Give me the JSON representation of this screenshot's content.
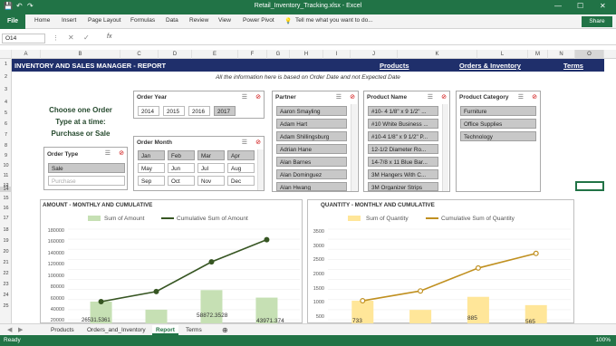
{
  "window": {
    "title": "Retail_Inventory_Tracking.xlsx - Excel",
    "minimize": "—",
    "maximize": "☐",
    "close": "✕"
  },
  "ribbon": {
    "file": "File",
    "tabs": [
      "Home",
      "Insert",
      "Page Layout",
      "Formulas",
      "Data",
      "Review",
      "View",
      "Power Pivot"
    ],
    "tell": "Tell me what you want to do...",
    "share": "Share"
  },
  "formula_bar": {
    "namebox": "O14",
    "fx": "fx",
    "value": ""
  },
  "columns": [
    "A",
    "B",
    "C",
    "D",
    "E",
    "F",
    "G",
    "H",
    "I",
    "J",
    "K",
    "L",
    "M",
    "N",
    "O"
  ],
  "rows": [
    "1",
    "2",
    "3",
    "4",
    "5",
    "6",
    "7",
    "8",
    "9",
    "10",
    "11",
    "12",
    "13",
    "14",
    "15",
    "16",
    "17",
    "18",
    "19",
    "20",
    "21",
    "22",
    "23",
    "24",
    "25"
  ],
  "banner": {
    "title": "INVENTORY AND SALES MANAGER - REPORT",
    "links": [
      "Products",
      "Orders & Inventory",
      "Terms"
    ]
  },
  "info_text": "All the information here is based on Order Date and not Expected Date",
  "choose": {
    "line1": "Choose one Order",
    "line2": "Type at a time:",
    "line3": "Purchase or Sale"
  },
  "slicers": {
    "order_year": {
      "title": "Order Year",
      "items": [
        "2014",
        "2015",
        "2016",
        "2017"
      ],
      "selected": "2017"
    },
    "order_month": {
      "title": "Order Month",
      "items": [
        "Jan",
        "Feb",
        "Mar",
        "Apr",
        "May",
        "Jun",
        "Jul",
        "Aug",
        "Sep",
        "Oct",
        "Nov",
        "Dec"
      ]
    },
    "order_type": {
      "title": "Order Type",
      "items": [
        "Sale",
        "Purchase"
      ]
    },
    "partner": {
      "title": "Partner",
      "items": [
        "Aaron Smayling",
        "Adam Hart",
        "Adam Shillingsburg",
        "Adrian Hane",
        "Alan Barnes",
        "Alan Dominguez",
        "Alan Hwang"
      ]
    },
    "product_name": {
      "title": "Product Name",
      "items": [
        "#10- 4 1/8\" x 9 1/2\" ...",
        "#10 White Business ...",
        "#10-4 1/8\" x 9 1/2\" P...",
        "12-1/2 Diameter Ro...",
        "14-7/8 x 11 Blue Bar...",
        "3M Hangers With C...",
        "3M Organizer Strips"
      ]
    },
    "product_category": {
      "title": "Product Category",
      "items": [
        "Furniture",
        "Office Supplies",
        "Technology"
      ]
    }
  },
  "chart_amount": {
    "title": "AMOUNT - MONTHLY AND CUMULATIVE",
    "legend": [
      "Sum of Amount",
      "Cumulative Sum of Amount"
    ],
    "yticks": [
      "180000",
      "160000",
      "140000",
      "120000",
      "100000",
      "80000",
      "60000",
      "40000",
      "20000"
    ],
    "labels": [
      "26531.5361",
      "58872.3528",
      "43971.374"
    ]
  },
  "chart_quantity": {
    "title": "QUANTITY - MONTHLY AND CUMULATIVE",
    "legend": [
      "Sum of Quantity",
      "Cumulative Sum of Quantity"
    ],
    "yticks": [
      "3500",
      "3000",
      "2500",
      "2000",
      "1500",
      "1000",
      "500"
    ],
    "labels": [
      "733",
      "885",
      "565"
    ]
  },
  "chart_data": [
    {
      "type": "bar",
      "title": "AMOUNT - MONTHLY AND CUMULATIVE",
      "series": [
        {
          "name": "Sum of Amount",
          "values": [
            36000,
            20000,
            58872.3528,
            43971.374
          ]
        },
        {
          "name": "Cumulative Sum of Amount",
          "values": [
            36000,
            56000,
            115000,
            159000
          ]
        }
      ],
      "ylim": [
        0,
        180000
      ]
    },
    {
      "type": "bar",
      "title": "QUANTITY - MONTHLY AND CUMULATIVE",
      "series": [
        {
          "name": "Sum of Quantity",
          "values": [
            733,
            380,
            885,
            565
          ]
        },
        {
          "name": "Cumulative Sum of Quantity",
          "values": [
            733,
            1113,
            1998,
            2563
          ]
        }
      ],
      "ylim": [
        0,
        3500
      ]
    }
  ],
  "sheet_tabs": [
    "Products",
    "Orders_and_Inventory",
    "Report",
    "Terms"
  ],
  "active_tab": "Report",
  "status": {
    "ready": "Ready",
    "zoom": "100%"
  },
  "colors": {
    "excel_green": "#217346",
    "banner": "#1f2f6b",
    "bar_green": "#c6e0b4",
    "line_green": "#375623",
    "bar_yellow": "#ffe699",
    "line_gold": "#c09020"
  }
}
